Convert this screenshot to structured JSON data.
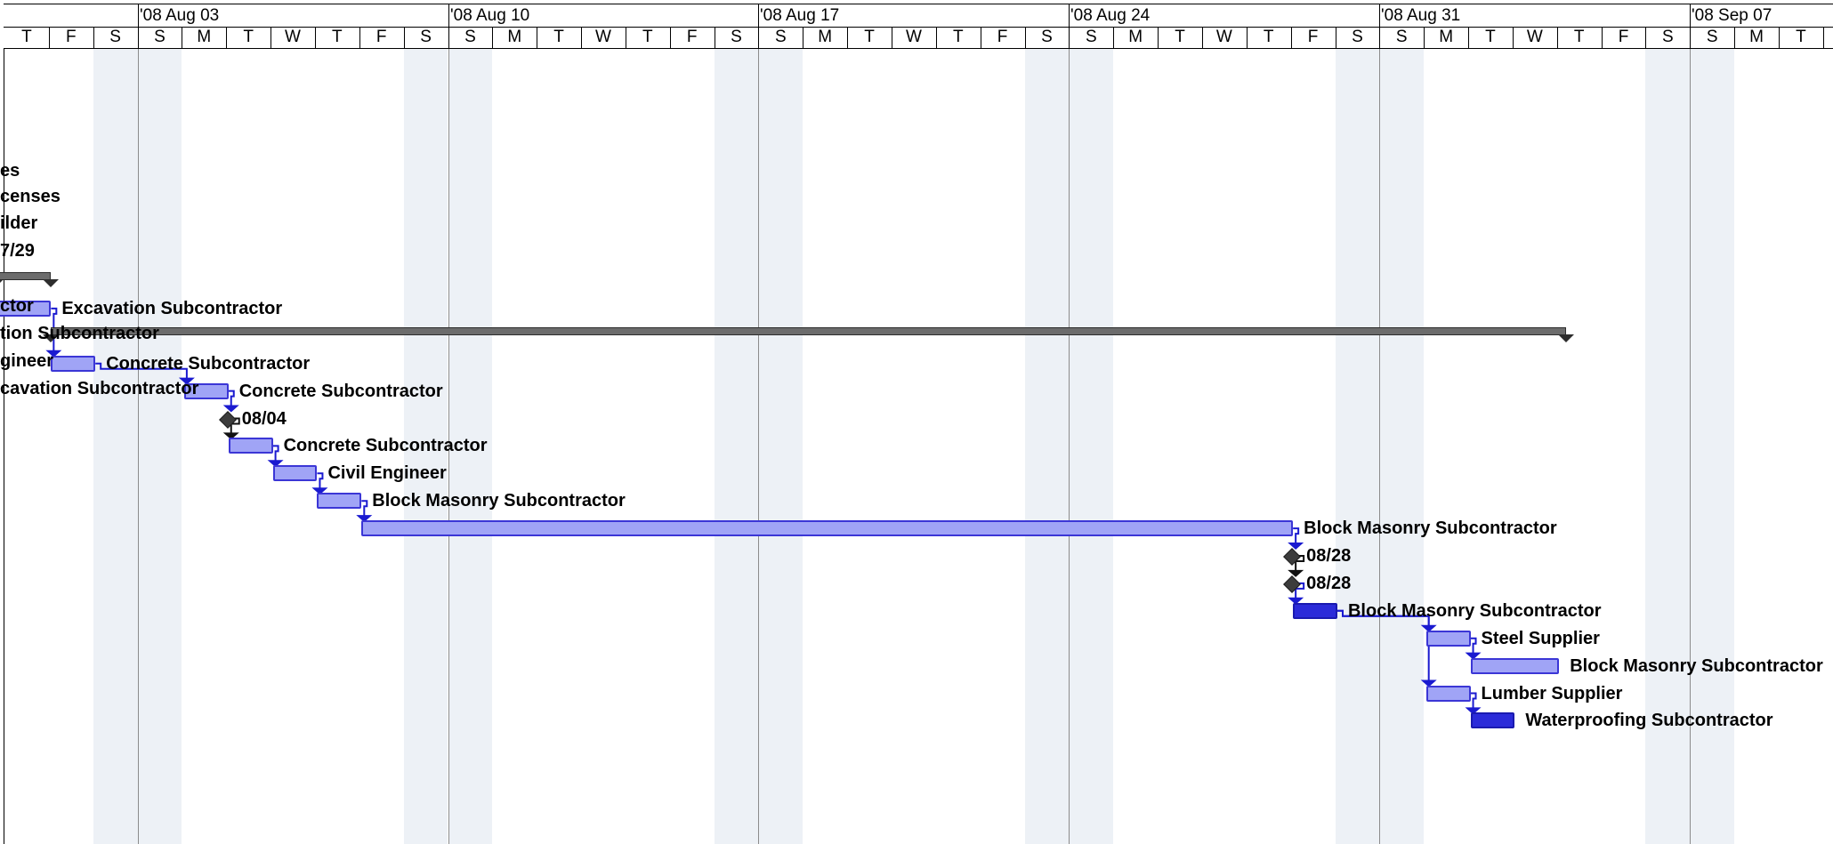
{
  "weeks": [
    "'08 Aug 03",
    "'08 Aug 10",
    "'08 Aug 17",
    "'08 Aug 24",
    "'08 Aug 31",
    "'08 Sep 07"
  ],
  "days": [
    "T",
    "F",
    "S",
    "S",
    "M",
    "T",
    "W",
    "T",
    "F",
    "S",
    "S",
    "M",
    "T",
    "W",
    "T",
    "F",
    "S",
    "S",
    "M",
    "T",
    "W",
    "T",
    "F",
    "S",
    "S",
    "M",
    "T",
    "W",
    "T",
    "F",
    "S",
    "S",
    "M",
    "T",
    "W",
    "T",
    "F",
    "S",
    "S",
    "M",
    "T"
  ],
  "colors": {
    "bar_fill": "#a0a4f6",
    "bar_border": "#3b36d6",
    "critical_fill": "#2b2bd9",
    "summary_fill": "#6c6c6c",
    "link": "#1a1ad0",
    "weekend_shade": "#edf1f6"
  },
  "left_labels": [
    "es",
    "censes",
    "ilder",
    "7/29",
    "ctor",
    "tion Subcontractor",
    "gineer",
    "cavation Subcontractor"
  ],
  "rows": [
    {
      "type": "summary",
      "start": -0.2,
      "end": 1.05
    },
    {
      "type": "task",
      "start": -0.2,
      "end": 1.05,
      "label": "Excavation Subcontractor"
    },
    {
      "type": "summary",
      "start": 1.05,
      "end": 35.2
    },
    {
      "type": "task",
      "start": 1.05,
      "end": 2.05,
      "label": "Concrete Subcontractor"
    },
    {
      "type": "task",
      "start": 4.05,
      "end": 5.05,
      "label": "Concrete Subcontractor"
    },
    {
      "type": "milestone",
      "start": 5.05,
      "label": "08/04"
    },
    {
      "type": "task",
      "start": 5.05,
      "end": 6.05,
      "label": "Concrete Subcontractor"
    },
    {
      "type": "task",
      "start": 6.05,
      "end": 7.05,
      "label": "Civil Engineer"
    },
    {
      "type": "task",
      "start": 7.05,
      "end": 8.05,
      "label": "Block Masonry Subcontractor"
    },
    {
      "type": "task",
      "start": 8.05,
      "end": 29.05,
      "label": "Block Masonry Subcontractor"
    },
    {
      "type": "milestone",
      "start": 29.05,
      "label": "08/28"
    },
    {
      "type": "milestone",
      "start": 29.05,
      "label": "08/28"
    },
    {
      "type": "critical",
      "start": 29.05,
      "end": 30.05,
      "label": "Block Masonry Subcontractor"
    },
    {
      "type": "task",
      "start": 32.05,
      "end": 33.05,
      "label": "Steel Supplier"
    },
    {
      "type": "task",
      "start": 33.05,
      "end": 35.05,
      "label": "Block Masonry Subcontractor"
    },
    {
      "type": "task",
      "start": 32.05,
      "end": 33.05,
      "label": "Lumber Supplier"
    },
    {
      "type": "critical",
      "start": 33.05,
      "end": 34.05,
      "label": "Waterproofing Subcontractor"
    }
  ]
}
